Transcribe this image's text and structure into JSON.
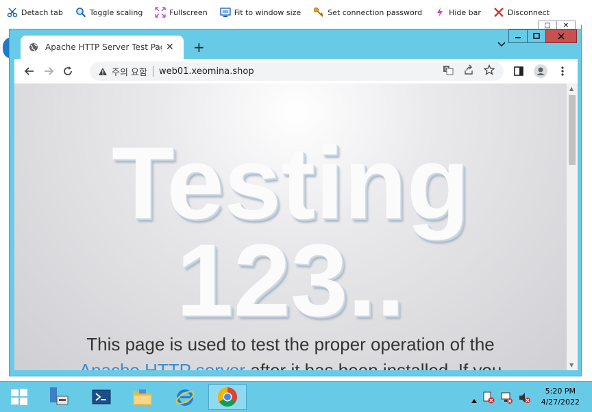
{
  "rdp_toolbar": {
    "items": [
      {
        "label": "Detach tab",
        "icon": "scissors-icon"
      },
      {
        "label": "Toggle scaling",
        "icon": "magnifier-icon"
      },
      {
        "label": "Fullscreen",
        "icon": "fullscreen-icon"
      },
      {
        "label": "Fit to window size",
        "icon": "monitor-icon"
      },
      {
        "label": "Set connection password",
        "icon": "key-icon"
      },
      {
        "label": "Hide bar",
        "icon": "lightning-icon"
      },
      {
        "label": "Disconnect",
        "icon": "x-icon"
      }
    ]
  },
  "browser": {
    "tab_title": "Apache HTTP Server Test Page p",
    "security_label": "주의 요함",
    "url": "web01.xeomina.shop"
  },
  "page": {
    "heading_line1": "Testing",
    "heading_line2": "123..",
    "para_line1": "This page is used to test the proper operation of the",
    "para_link": "Apache HTTP server",
    "para_line2_rest": " after it has been installed. If you"
  },
  "taskbar": {
    "time": "5:20 PM",
    "date": "4/27/2022"
  },
  "colors": {
    "chrome_frame": "#67cbe8",
    "close_button": "#c75050",
    "link": "#3b8bd0"
  }
}
